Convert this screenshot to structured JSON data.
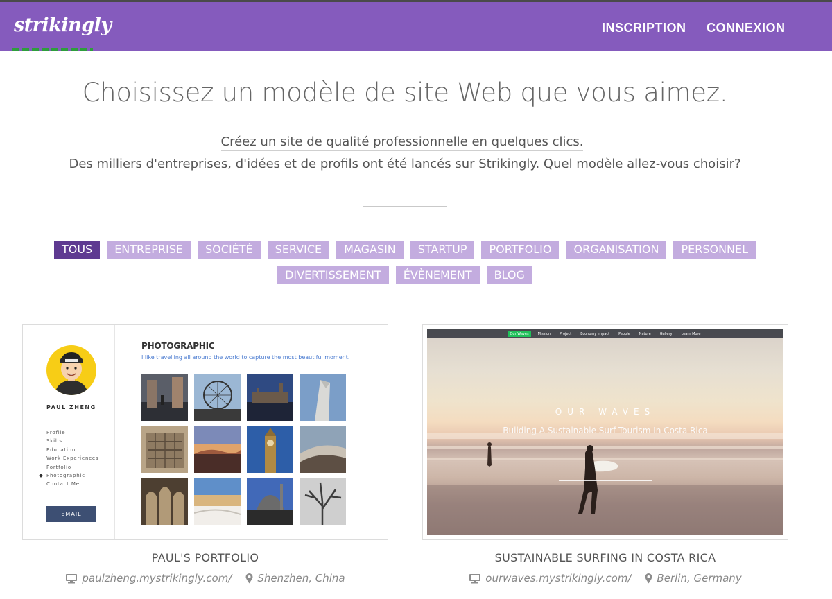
{
  "header": {
    "logo": "strikingly",
    "signup": "INSCRIPTION",
    "login": "CONNEXION"
  },
  "hero": {
    "title": "Choisissez un modèle de site Web que vous aimez.",
    "subtitle_link": "Créez un site de qualité professionnelle en quelques clics.",
    "subtitle": "Des milliers d'entreprises, d'idées et de profils ont été lancés sur Strikingly. Quel modèle allez-vous choisir?"
  },
  "filters": {
    "row1": [
      "TOUS",
      "ENTREPRISE",
      "SOCIÉTÉ",
      "SERVICE",
      "MAGASIN",
      "STARTUP",
      "PORTFOLIO",
      "ORGANISATION",
      "PERSONNEL"
    ],
    "row2": [
      "DIVERTISSEMENT",
      "ÉVÈNEMENT",
      "BLOG"
    ],
    "active": "TOUS"
  },
  "templates": [
    {
      "name": "PAUL'S PORTFOLIO",
      "url": "paulzheng.mystrikingly.com/",
      "location": "Shenzhen, China",
      "preview": {
        "person_name": "PAUL ZHENG",
        "menu": [
          "Profile",
          "Skills",
          "Education",
          "Work Experiences",
          "Portfolio",
          "Photographic",
          "Contact Me"
        ],
        "menu_current": "Photographic",
        "email_button": "EMAIL",
        "section_title": "PHOTOGRAPHIC",
        "section_quote": "I like travelling all around the world to capture the most beautiful moment."
      }
    },
    {
      "name": "SUSTAINABLE SURFING IN COSTA RICA",
      "url": "ourwaves.mystrikingly.com/",
      "location": "Berlin, Germany",
      "preview": {
        "nav": [
          "Our Waves",
          "Mission",
          "Project",
          "Economy Impact",
          "People",
          "Nature",
          "Gallery",
          "Learn More"
        ],
        "nav_current": "Our Waves",
        "title": "OUR WAVES",
        "subtitle": "Building A Sustainable Surf Tourism In Costa Rica"
      }
    }
  ],
  "icons": {
    "url": "monitor-icon",
    "location": "map-pin-icon"
  },
  "colors": {
    "header_bg": "#855bbd",
    "tag_bg": "#c3acdf",
    "tag_active_bg": "#5e3a91"
  }
}
